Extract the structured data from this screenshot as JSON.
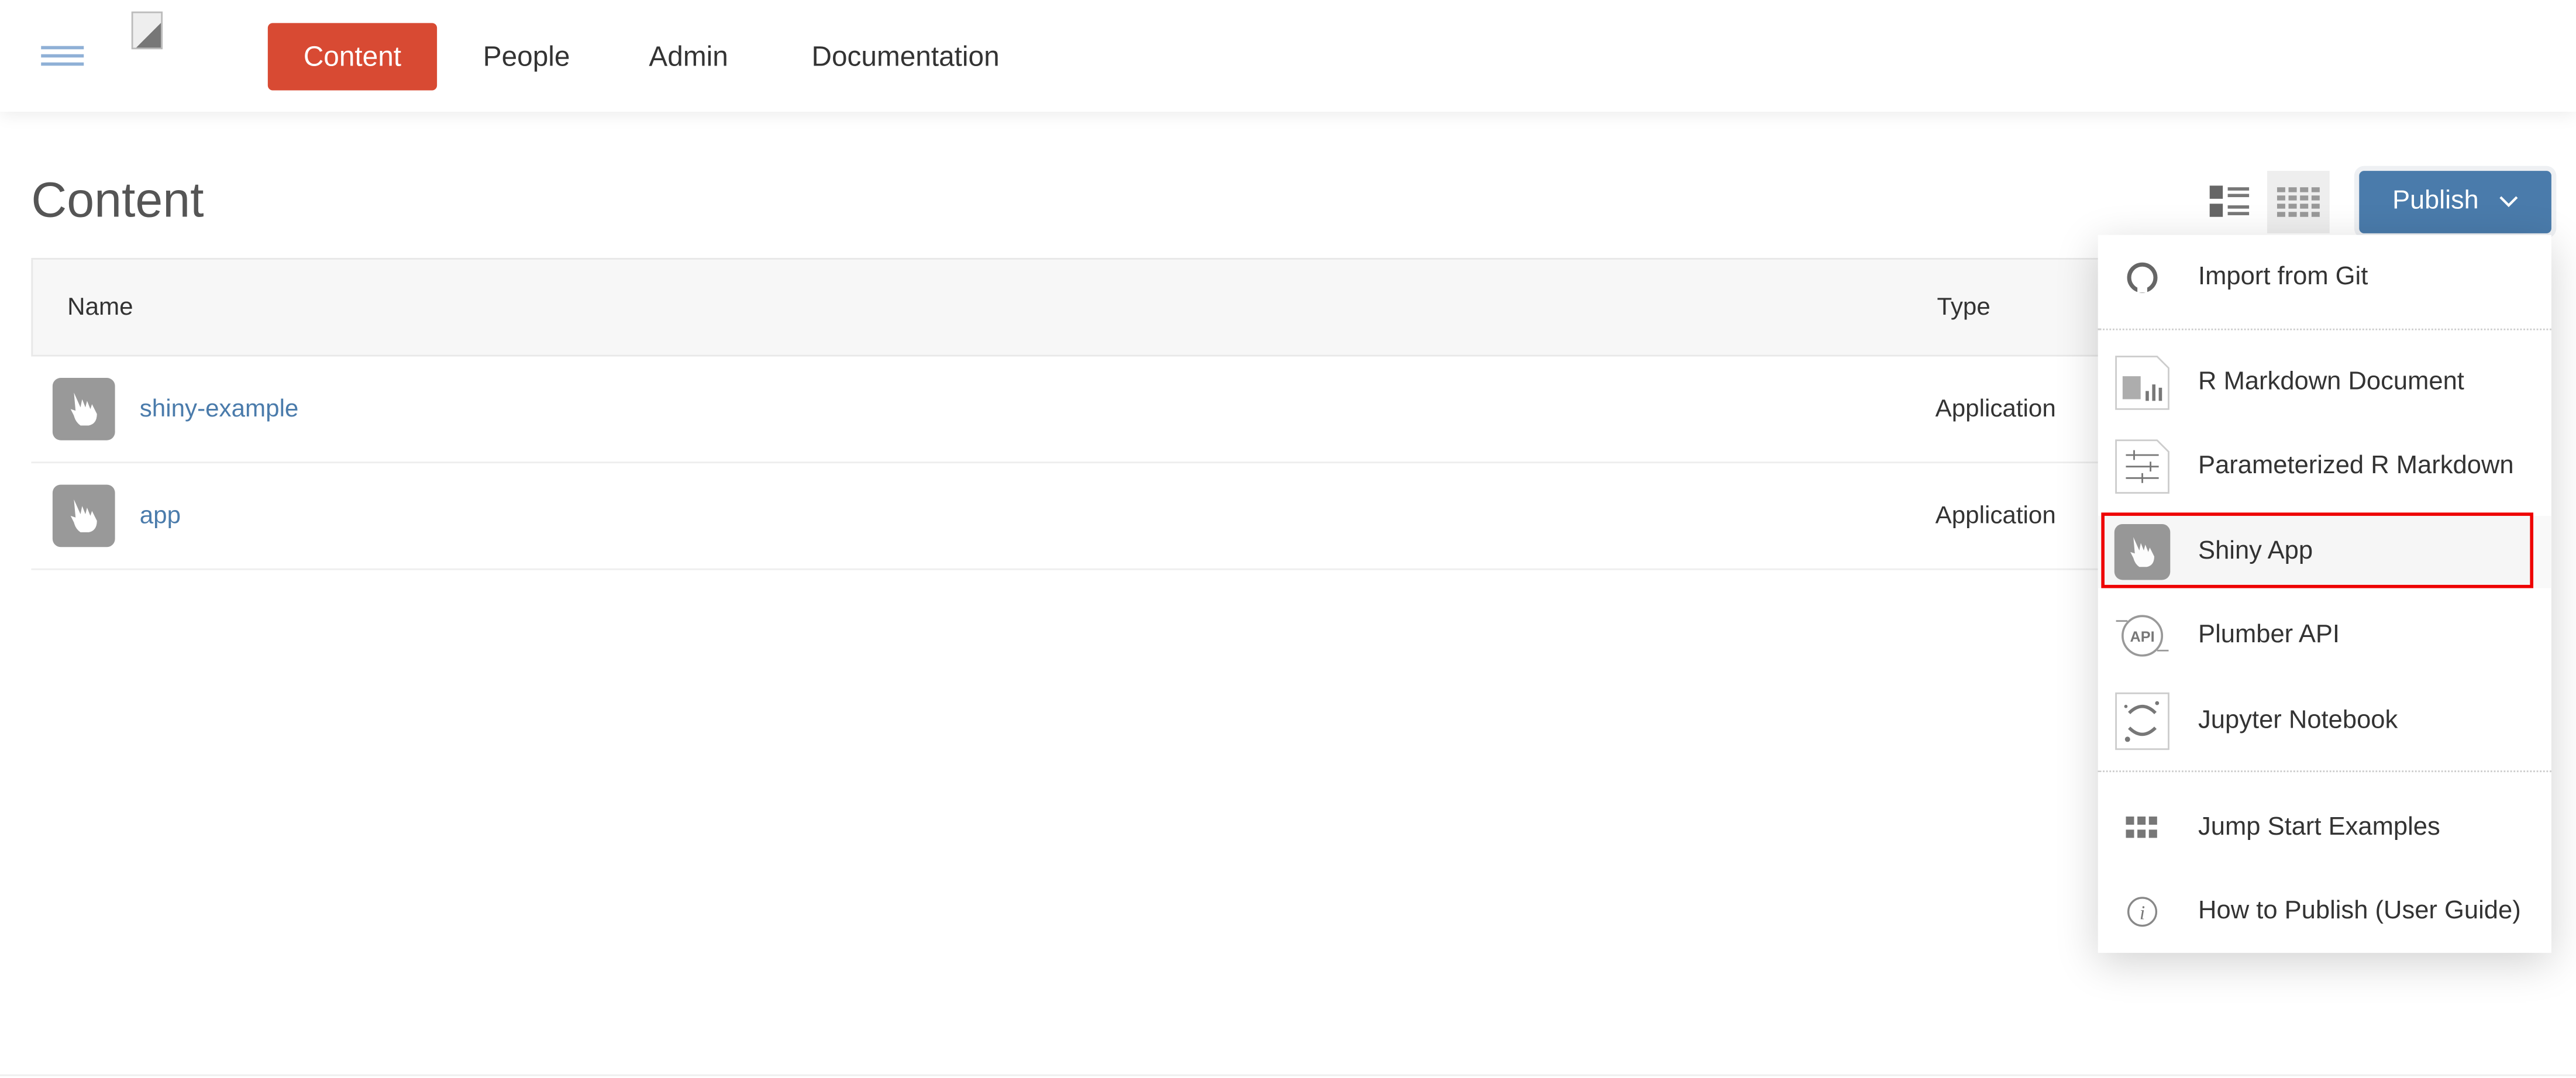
{
  "header": {
    "nav": [
      {
        "label": "Content",
        "active": true
      },
      {
        "label": "People"
      },
      {
        "label": "Admin"
      },
      {
        "label": "Documentation"
      }
    ]
  },
  "page": {
    "title": "Content"
  },
  "table": {
    "columns": [
      "Name",
      "Type"
    ],
    "rows": [
      {
        "name": "shiny-example",
        "type": "Application",
        "icon": "shiny-hand-icon"
      },
      {
        "name": "app",
        "type": "Application",
        "icon": "shiny-hand-icon"
      }
    ]
  },
  "toolbar": {
    "publish_label": "Publish",
    "views": [
      "list-view-icon",
      "grid-view-icon"
    ],
    "selected_view": "grid"
  },
  "publish_menu": {
    "items": [
      {
        "label": "Import from Git",
        "icon": "github-icon"
      },
      {
        "label": "R Markdown Document",
        "icon": "rmarkdown-document-icon"
      },
      {
        "label": "Parameterized R Markdown",
        "icon": "parameterized-rmarkdown-icon"
      },
      {
        "label": "Shiny App",
        "icon": "shiny-app-icon",
        "highlighted": true
      },
      {
        "label": "Plumber API",
        "icon": "plumber-api-icon"
      },
      {
        "label": "Jupyter Notebook",
        "icon": "jupyter-icon"
      },
      {
        "label": "Jump Start Examples",
        "icon": "grid-icon"
      },
      {
        "label": "How to Publish (User Guide)",
        "icon": "info-icon"
      }
    ],
    "api_icon_text": "API"
  },
  "colors": {
    "accent": "#d84a33",
    "primary": "#4a7bab",
    "highlight": "#e00000",
    "icon_gray": "#999999"
  }
}
